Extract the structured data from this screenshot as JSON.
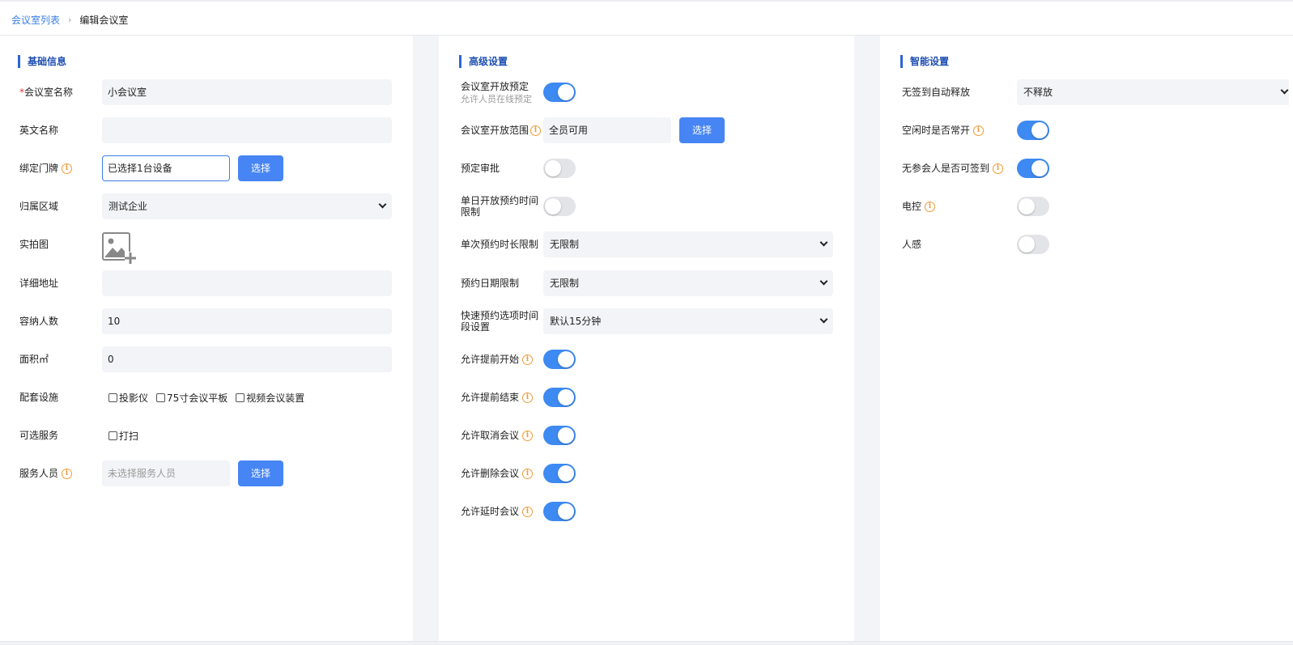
{
  "breadcrumb": {
    "parent": "会议室列表",
    "separator": "›",
    "current": "编辑会议室"
  },
  "basic": {
    "title": "基础信息",
    "name": {
      "required_mark": "*",
      "label": "会议室名称",
      "value": "小会议室"
    },
    "english_name": {
      "label": "英文名称",
      "value": ""
    },
    "door_sign": {
      "label": "绑定门牌",
      "value": "已选择1台设备",
      "button": "选择"
    },
    "area": {
      "label": "归属区域",
      "value": "测试企业"
    },
    "photo": {
      "label": "实拍图"
    },
    "address": {
      "label": "详细地址",
      "value": ""
    },
    "capacity": {
      "label": "容纳人数",
      "value": "10"
    },
    "size": {
      "label": "面积㎡",
      "value": "0"
    },
    "facilities": {
      "label": "配套设施",
      "options": [
        "投影仪",
        "75寸会议平板",
        "视频会议装置"
      ]
    },
    "services": {
      "label": "可选服务",
      "options": [
        "打扫"
      ]
    },
    "staff": {
      "label": "服务人员",
      "placeholder": "未选择服务人员",
      "button": "选择"
    }
  },
  "advanced": {
    "title": "高级设置",
    "open_booking": {
      "label": "会议室开放预定",
      "sub": "允许人员在线预定",
      "on": true
    },
    "open_scope": {
      "label": "会议室开放范围",
      "value": "全员可用",
      "button": "选择"
    },
    "approval": {
      "label": "预定审批",
      "on": false
    },
    "daily_limit": {
      "label": "单日开放预约时间限制",
      "on": false
    },
    "duration_limit": {
      "label": "单次预约时长限制",
      "value": "无限制"
    },
    "date_limit": {
      "label": "预约日期限制",
      "value": "无限制"
    },
    "quick_option": {
      "label": "快速预约选项时间段设置",
      "value": "默认15分钟"
    },
    "early_start": {
      "label": "允许提前开始",
      "on": true
    },
    "early_end": {
      "label": "允许提前结束",
      "on": true
    },
    "cancel": {
      "label": "允许取消会议",
      "on": true
    },
    "delete": {
      "label": "允许删除会议",
      "on": true
    },
    "extend": {
      "label": "允许延时会议",
      "on": true
    }
  },
  "smart": {
    "title": "智能设置",
    "auto_release": {
      "label": "无签到自动释放",
      "value": "不释放"
    },
    "idle_open": {
      "label": "空闲时是否常开",
      "on": true
    },
    "no_attendee_sign": {
      "label": "无参会人是否可签到",
      "on": true
    },
    "power": {
      "label": "电控",
      "on": false
    },
    "sensor": {
      "label": "人感",
      "on": false
    }
  },
  "colors": {
    "accent": "#4785f4",
    "toggle_on": "#3d8af2",
    "title": "#1f4fb3",
    "info": "#f29b38"
  }
}
